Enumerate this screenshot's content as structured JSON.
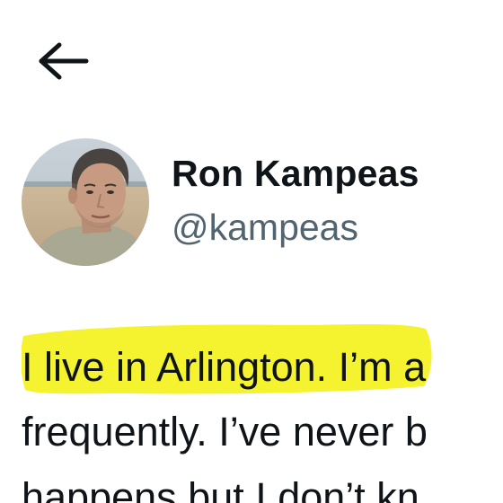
{
  "nav": {
    "back_icon": "arrow-left-icon"
  },
  "author": {
    "display_name": "Ron Kampeas",
    "handle": "@kampeas",
    "avatar_icon": "profile-photo"
  },
  "tweet": {
    "lines": [
      "I live in Arlington. I’m a",
      "frequently. I’ve never b",
      "happens but I don’t kn"
    ],
    "highlight_color": "#f4f21a"
  },
  "colors": {
    "text_primary": "#0f1419",
    "text_secondary": "#536471",
    "background": "#ffffff"
  }
}
